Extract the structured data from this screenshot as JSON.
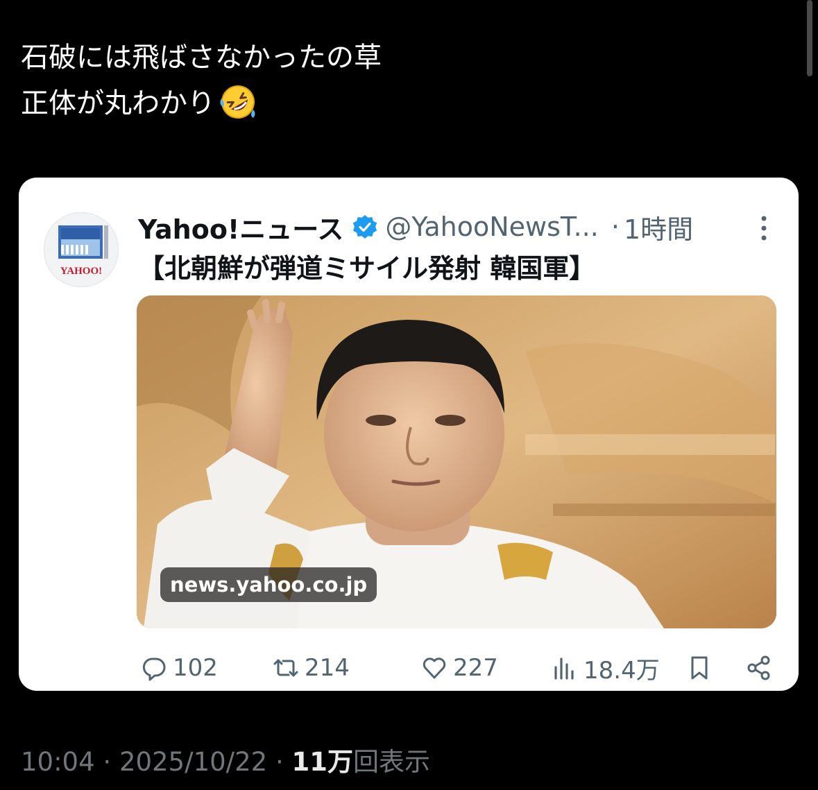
{
  "post": {
    "line1": "石破には飛ばさなかったの草",
    "line2": "正体が丸わかり",
    "emoji": "rolling-on-floor-laughing-emoji"
  },
  "quoted": {
    "avatar_text": "YAHOO!",
    "name": "Yahoo!ニュース",
    "handle": "@YahooNewsT...",
    "separator": "·",
    "time": "1時間",
    "headline": "【北朝鮮が弾道ミサイル発射 韓国軍】",
    "link_label": "news.yahoo.co.jp",
    "stats": {
      "replies": "102",
      "reposts": "214",
      "likes": "227",
      "views": "18.4万"
    }
  },
  "meta": {
    "time": "10:04",
    "sep1": " · ",
    "date": "2025/10/22",
    "sep2": " · ",
    "views_count": "11万",
    "views_label": "回表示"
  },
  "colors": {
    "background": "#000000",
    "card": "#ffffff",
    "verified": "#1d9bf0",
    "muted": "#536471"
  }
}
